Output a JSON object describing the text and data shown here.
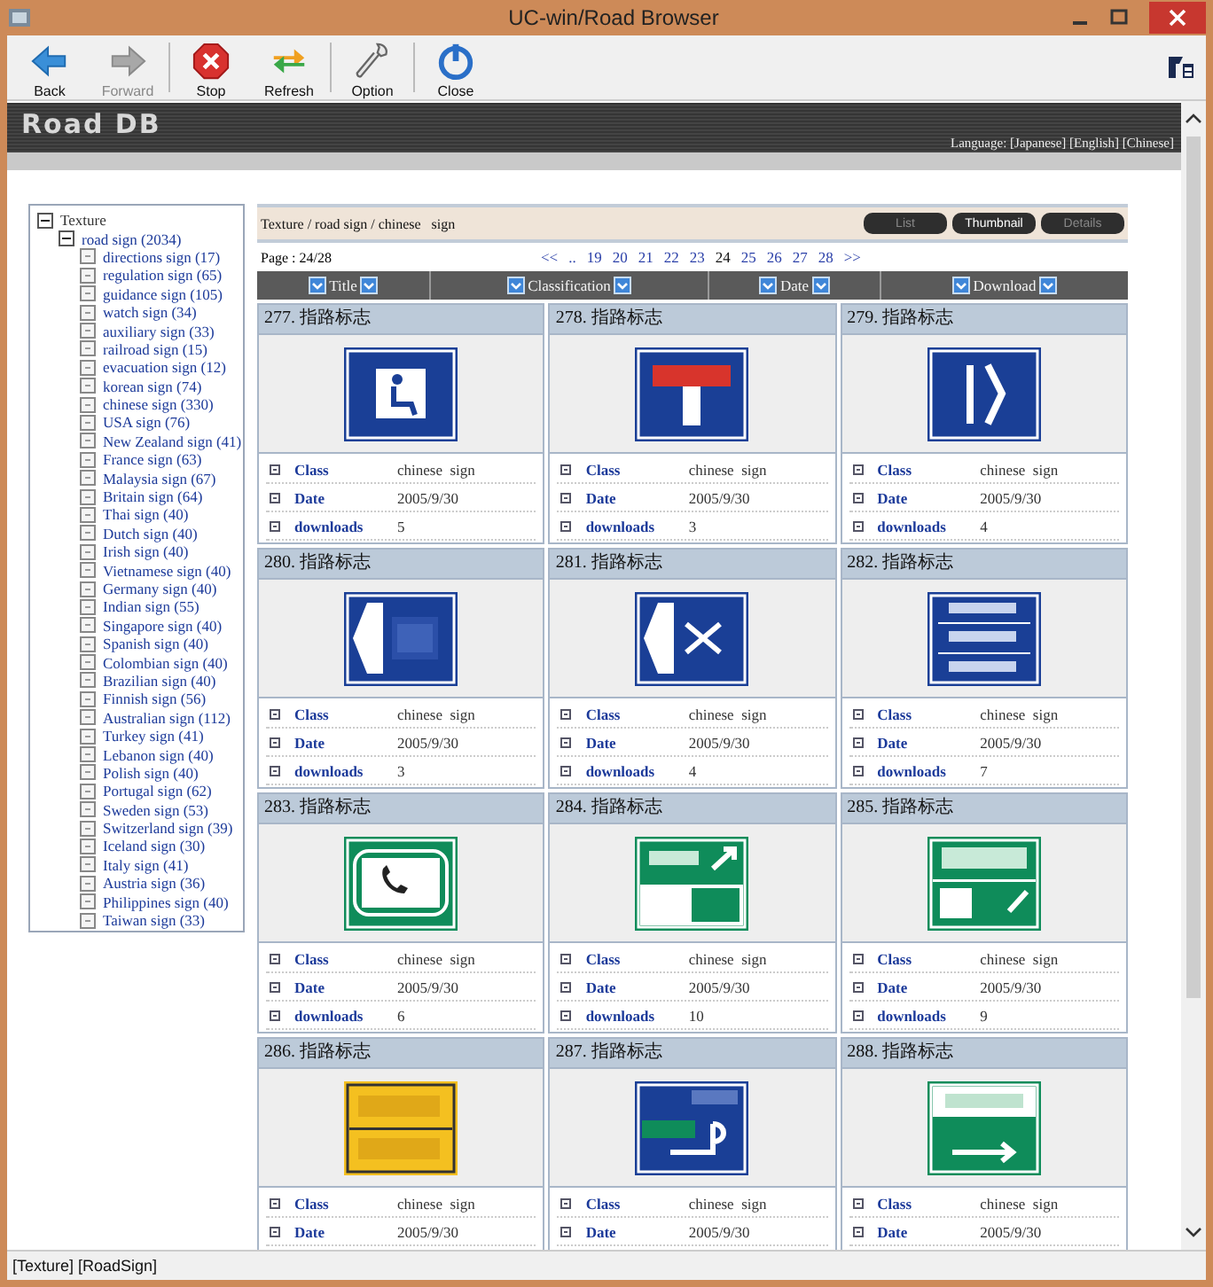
{
  "window": {
    "title": "UC-win/Road Browser"
  },
  "toolbar": {
    "groups": [
      [
        {
          "label": "Back",
          "kind": "back",
          "disabled": false
        },
        {
          "label": "Forward",
          "kind": "forward",
          "disabled": true
        }
      ],
      [
        {
          "label": "Stop",
          "kind": "stop",
          "disabled": false
        },
        {
          "label": "Refresh",
          "kind": "refresh",
          "disabled": false
        }
      ],
      [
        {
          "label": "Option",
          "kind": "option",
          "disabled": false
        }
      ],
      [
        {
          "label": "Close",
          "kind": "close",
          "disabled": false
        }
      ]
    ]
  },
  "banner": {
    "logo": "Road DB",
    "language_label": "Language:",
    "languages": [
      "[Japanese]",
      "[English]",
      "[Chinese]"
    ]
  },
  "sidebar": {
    "tree": [
      {
        "label": "Texture",
        "expanded": true,
        "children": [
          {
            "label": "road sign (2034)",
            "expanded": true,
            "children": [
              {
                "label": "directions sign (17)"
              },
              {
                "label": "regulation sign (65)"
              },
              {
                "label": "guidance sign (105)"
              },
              {
                "label": "watch sign (34)"
              },
              {
                "label": "auxiliary sign (33)"
              },
              {
                "label": "railroad sign (15)"
              },
              {
                "label": "evacuation sign (12)"
              },
              {
                "label": "korean sign (74)"
              },
              {
                "label": "chinese sign (330)"
              },
              {
                "label": "USA sign (76)"
              },
              {
                "label": "New Zealand sign (41)"
              },
              {
                "label": "France sign (63)"
              },
              {
                "label": "Malaysia sign (67)"
              },
              {
                "label": "Britain sign (64)"
              },
              {
                "label": "Thai sign (40)"
              },
              {
                "label": "Dutch sign (40)"
              },
              {
                "label": "Irish sign (40)"
              },
              {
                "label": "Vietnamese sign (40)"
              },
              {
                "label": "Germany sign (40)"
              },
              {
                "label": "Indian sign (55)"
              },
              {
                "label": "Singapore sign (40)"
              },
              {
                "label": "Spanish sign (40)"
              },
              {
                "label": "Colombian sign (40)"
              },
              {
                "label": "Brazilian sign (40)"
              },
              {
                "label": "Finnish sign (56)"
              },
              {
                "label": "Australian sign (112)"
              },
              {
                "label": "Turkey sign (41)"
              },
              {
                "label": "Lebanon sign (40)"
              },
              {
                "label": "Polish sign (40)"
              },
              {
                "label": "Portugal sign (62)"
              },
              {
                "label": "Sweden sign (53)"
              },
              {
                "label": "Switzerland sign (39)"
              },
              {
                "label": "Iceland sign (30)"
              },
              {
                "label": "Italy sign (41)"
              },
              {
                "label": "Austria sign (36)"
              },
              {
                "label": "Philippines sign (40)"
              },
              {
                "label": "Taiwan sign (33)"
              }
            ]
          }
        ]
      }
    ]
  },
  "breadcrumb": "Texture / road sign / chinese   sign",
  "view_buttons": [
    {
      "label": "List",
      "selected": false
    },
    {
      "label": "Thumbnail",
      "selected": true
    },
    {
      "label": "Details",
      "selected": false
    }
  ],
  "page_info": "Page : 24/28",
  "pagination": [
    {
      "label": "<<",
      "selected": false
    },
    {
      "label": "..",
      "selected": false
    },
    {
      "label": "19",
      "selected": false
    },
    {
      "label": "20",
      "selected": false
    },
    {
      "label": "21",
      "selected": false
    },
    {
      "label": "22",
      "selected": false
    },
    {
      "label": "23",
      "selected": false
    },
    {
      "label": "24",
      "selected": true
    },
    {
      "label": "25",
      "selected": false
    },
    {
      "label": "26",
      "selected": false
    },
    {
      "label": "27",
      "selected": false
    },
    {
      "label": "28",
      "selected": false
    },
    {
      "label": ">>",
      "selected": false
    }
  ],
  "columns": [
    {
      "label": "Title"
    },
    {
      "label": "Classification"
    },
    {
      "label": "Date"
    },
    {
      "label": "Download"
    }
  ],
  "cards": [
    {
      "title": "277. 指路标志",
      "fields": [
        {
          "label": "Class",
          "value": "chinese  sign"
        },
        {
          "label": "Date",
          "value": "2005/9/30"
        },
        {
          "label": "downloads",
          "value": "5"
        }
      ]
    },
    {
      "title": "278. 指路标志",
      "fields": [
        {
          "label": "Class",
          "value": "chinese  sign"
        },
        {
          "label": "Date",
          "value": "2005/9/30"
        },
        {
          "label": "downloads",
          "value": "3"
        }
      ]
    },
    {
      "title": "279. 指路标志",
      "fields": [
        {
          "label": "Class",
          "value": "chinese  sign"
        },
        {
          "label": "Date",
          "value": "2005/9/30"
        },
        {
          "label": "downloads",
          "value": "4"
        }
      ]
    },
    {
      "title": "280. 指路标志",
      "fields": [
        {
          "label": "Class",
          "value": "chinese  sign"
        },
        {
          "label": "Date",
          "value": "2005/9/30"
        },
        {
          "label": "downloads",
          "value": "3"
        }
      ]
    },
    {
      "title": "281. 指路标志",
      "fields": [
        {
          "label": "Class",
          "value": "chinese  sign"
        },
        {
          "label": "Date",
          "value": "2005/9/30"
        },
        {
          "label": "downloads",
          "value": "4"
        }
      ]
    },
    {
      "title": "282. 指路标志",
      "fields": [
        {
          "label": "Class",
          "value": "chinese  sign"
        },
        {
          "label": "Date",
          "value": "2005/9/30"
        },
        {
          "label": "downloads",
          "value": "7"
        }
      ]
    },
    {
      "title": "283. 指路标志",
      "fields": [
        {
          "label": "Class",
          "value": "chinese  sign"
        },
        {
          "label": "Date",
          "value": "2005/9/30"
        },
        {
          "label": "downloads",
          "value": "6"
        }
      ]
    },
    {
      "title": "284. 指路标志",
      "fields": [
        {
          "label": "Class",
          "value": "chinese  sign"
        },
        {
          "label": "Date",
          "value": "2005/9/30"
        },
        {
          "label": "downloads",
          "value": "10"
        }
      ]
    },
    {
      "title": "285. 指路标志",
      "fields": [
        {
          "label": "Class",
          "value": "chinese  sign"
        },
        {
          "label": "Date",
          "value": "2005/9/30"
        },
        {
          "label": "downloads",
          "value": "9"
        }
      ]
    },
    {
      "title": "286. 指路标志",
      "fields": [
        {
          "label": "Class",
          "value": "chinese  sign"
        },
        {
          "label": "Date",
          "value": "2005/9/30"
        }
      ]
    },
    {
      "title": "287. 指路标志",
      "fields": [
        {
          "label": "Class",
          "value": "chinese  sign"
        },
        {
          "label": "Date",
          "value": "2005/9/30"
        }
      ]
    },
    {
      "title": "288. 指路标志",
      "fields": [
        {
          "label": "Class",
          "value": "chinese  sign"
        },
        {
          "label": "Date",
          "value": "2005/9/30"
        }
      ]
    }
  ],
  "status_bar": "[Texture] [RoadSign]"
}
